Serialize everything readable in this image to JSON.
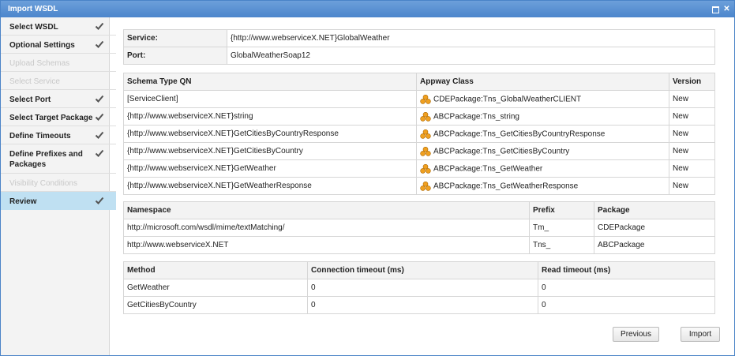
{
  "window": {
    "title": "Import WSDL"
  },
  "steps": [
    {
      "label": "Select WSDL",
      "state": "done"
    },
    {
      "label": "Optional Settings",
      "state": "done"
    },
    {
      "label": "Upload Schemas",
      "state": "disabled"
    },
    {
      "label": "Select Service",
      "state": "disabled"
    },
    {
      "label": "Select Port",
      "state": "done"
    },
    {
      "label": "Select Target Package",
      "state": "done"
    },
    {
      "label": "Define Timeouts",
      "state": "done"
    },
    {
      "label": "Define Prefixes and Packages",
      "state": "done"
    },
    {
      "label": "Visibility Conditions",
      "state": "disabled"
    },
    {
      "label": "Review",
      "state": "active"
    }
  ],
  "service_table": {
    "service_label": "Service:",
    "service_value": "{http://www.webserviceX.NET}GlobalWeather",
    "port_label": "Port:",
    "port_value": "GlobalWeatherSoap12"
  },
  "schema_table": {
    "headers": [
      "Schema Type QN",
      "Appway Class",
      "Version"
    ],
    "rows": [
      [
        "[ServiceClient]",
        "CDEPackage:Tns_GlobalWeatherCLIENT",
        "New"
      ],
      [
        "{http://www.webserviceX.NET}string",
        "ABCPackage:Tns_string",
        "New"
      ],
      [
        "{http://www.webserviceX.NET}GetCitiesByCountryResponse",
        "ABCPackage:Tns_GetCitiesByCountryResponse",
        "New"
      ],
      [
        "{http://www.webserviceX.NET}GetCitiesByCountry",
        "ABCPackage:Tns_GetCitiesByCountry",
        "New"
      ],
      [
        "{http://www.webserviceX.NET}GetWeather",
        "ABCPackage:Tns_GetWeather",
        "New"
      ],
      [
        "{http://www.webserviceX.NET}GetWeatherResponse",
        "ABCPackage:Tns_GetWeatherResponse",
        "New"
      ]
    ]
  },
  "namespace_table": {
    "headers": [
      "Namespace",
      "Prefix",
      "Package"
    ],
    "rows": [
      [
        "http://microsoft.com/wsdl/mime/textMatching/",
        "Tm_",
        "CDEPackage"
      ],
      [
        "http://www.webserviceX.NET",
        "Tns_",
        "ABCPackage"
      ]
    ]
  },
  "timeout_table": {
    "headers": [
      "Method",
      "Connection timeout (ms)",
      "Read timeout (ms)"
    ],
    "rows": [
      [
        "GetWeather",
        "0",
        "0"
      ],
      [
        "GetCitiesByCountry",
        "0",
        "0"
      ]
    ]
  },
  "buttons": {
    "previous": "Previous",
    "import": "Import"
  },
  "icons": {
    "check": "check-icon",
    "class": "package-class-icon",
    "maximize": "maximize-icon",
    "close": "close-icon"
  },
  "colors": {
    "titlebar": "#5a91d2",
    "active_step": "#bfe0f2",
    "check": "#555555",
    "class_icon": "#f0a020"
  }
}
